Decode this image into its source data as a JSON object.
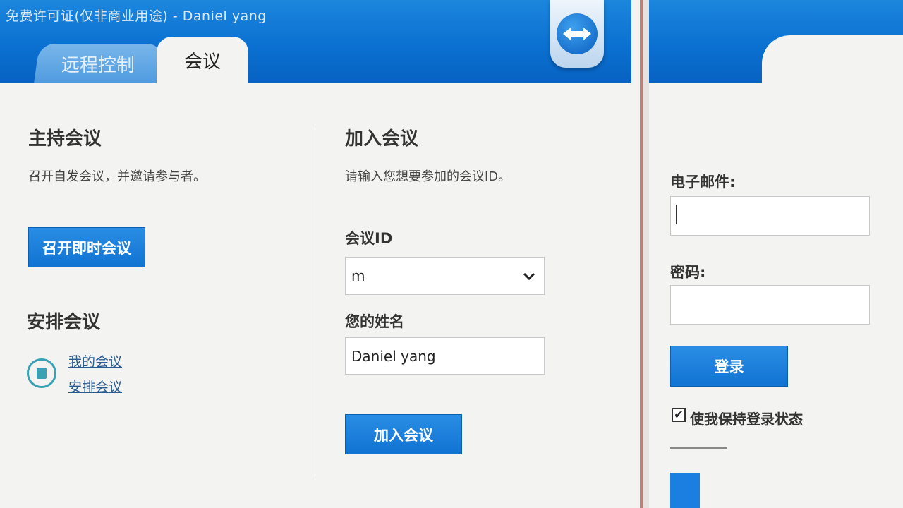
{
  "window": {
    "title": "免费许可证(仅非商业用途) - Daniel yang"
  },
  "tabs": [
    {
      "label": "远程控制"
    },
    {
      "label": "会议"
    }
  ],
  "host": {
    "title": "主持会议",
    "description": "召开自发会议，并邀请参与者。",
    "start_button": "召开即时会议"
  },
  "schedule": {
    "title": "安排会议",
    "links": [
      "我的会议",
      "安排会议"
    ],
    "icon": "calendar-icon"
  },
  "join": {
    "title": "加入会议",
    "description": "请输入您想要参加的会议ID。",
    "meeting_id_label": "会议ID",
    "meeting_id_value": "m",
    "name_label": "您的姓名",
    "name_value": "Daniel yang",
    "join_button": "加入会议"
  },
  "login": {
    "email_label": "电子邮件:",
    "email_value": "",
    "password_label": "密码:",
    "password_value": "",
    "login_button": "登录",
    "keep_logged_in": "使我保持登录状态",
    "keep_logged_in_checked": true,
    "checkmark": "✔"
  },
  "colors": {
    "header_blue": "#0a6fd0",
    "button_blue": "#1173d2",
    "link": "#2b5b8f"
  }
}
